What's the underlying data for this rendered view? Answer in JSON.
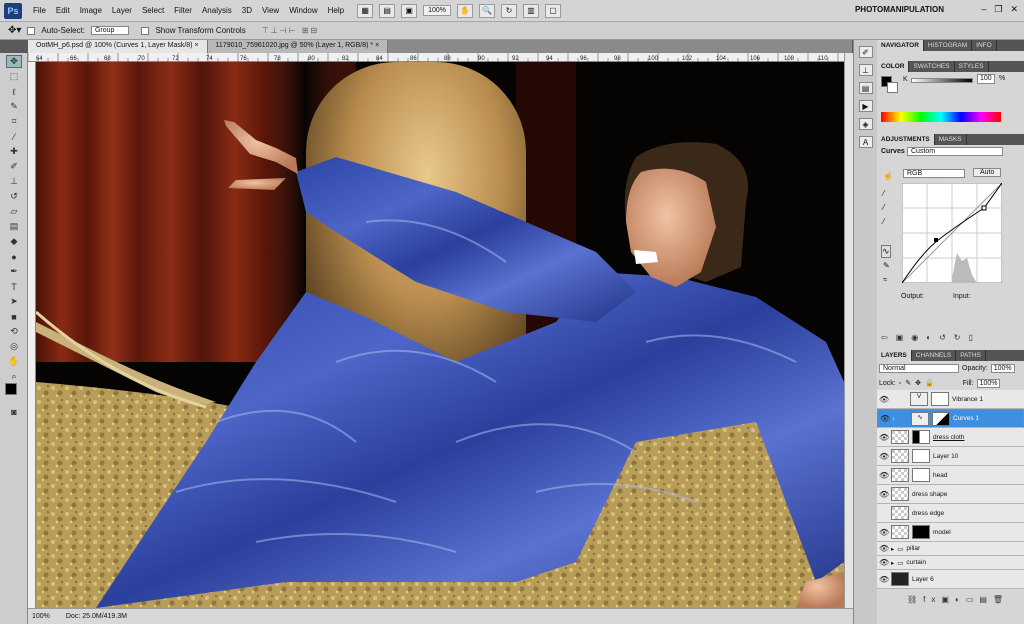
{
  "menubar": {
    "logo": "Ps",
    "items": [
      "File",
      "Edit",
      "Image",
      "Layer",
      "Select",
      "Filter",
      "Analysis",
      "3D",
      "View",
      "Window",
      "Help"
    ],
    "zoom": "100%",
    "workspace": "PHOTOMANIPULATION"
  },
  "options": {
    "auto_select_label": "Auto-Select:",
    "auto_select_value": "Group",
    "transform_label": "Show Transform Controls"
  },
  "tabs": [
    {
      "label": "OotMH_p6.psd @ 100% (Curves 1, Layer Mask/8) ×"
    },
    {
      "label": "1179010_75961020.jpg @ 50% (Layer 1, RGB/8) * ×"
    }
  ],
  "ruler": [
    "64",
    "66",
    "68",
    "70",
    "72",
    "74",
    "76",
    "78",
    "80",
    "82",
    "84",
    "86",
    "88",
    "90",
    "92",
    "94",
    "96",
    "98",
    "100",
    "102",
    "104",
    "106",
    "108",
    "110"
  ],
  "status": {
    "zoom": "100%",
    "doc": "Doc: 25.0M/419.3M"
  },
  "navigator": {
    "tabs": [
      "NAVIGATOR",
      "HISTOGRAM",
      "INFO"
    ]
  },
  "color": {
    "tabs": [
      "COLOR",
      "SWATCHES",
      "STYLES"
    ],
    "channel": "K",
    "value": "100",
    "unit": "%"
  },
  "adjustments": {
    "tabs": [
      "ADJUSTMENTS",
      "MASKS"
    ],
    "type": "Curves",
    "preset": "Custom",
    "channel": "RGB",
    "auto": "Auto",
    "output_label": "Output:",
    "input_label": "Input:"
  },
  "layers": {
    "tabs": [
      "LAYERS",
      "CHANNELS",
      "PATHS"
    ],
    "blend": "Normal",
    "opacity_label": "Opacity:",
    "opacity": "100%",
    "lock_label": "Lock:",
    "fill_label": "Fill:",
    "fill": "100%",
    "items": [
      {
        "name": "Vibrance 1"
      },
      {
        "name": "Curves 1"
      },
      {
        "name": "dress cloth"
      },
      {
        "name": "Layer 10"
      },
      {
        "name": "head"
      },
      {
        "name": "dress shape"
      },
      {
        "name": "dress edge"
      },
      {
        "name": "model"
      },
      {
        "name": "pillar"
      },
      {
        "name": "curtain"
      },
      {
        "name": "Layer 6"
      }
    ]
  }
}
